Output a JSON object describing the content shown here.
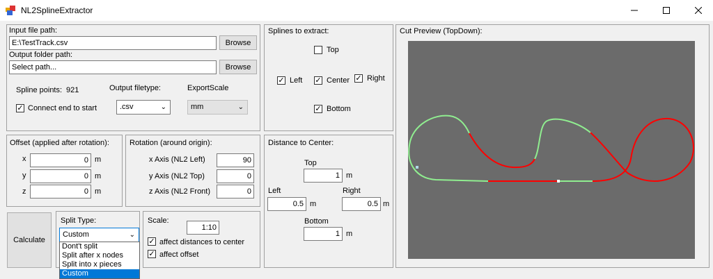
{
  "window": {
    "title": "NL2SplineExtractor",
    "minimize_icon": "minimize-icon",
    "maximize_icon": "maximize-icon",
    "close_icon": "close-icon"
  },
  "io": {
    "input_label": "Input file path:",
    "input_value": "E:\\TestTrack.csv",
    "browse_input": "Browse",
    "output_label": "Output folder path:",
    "output_value": "Select path...",
    "browse_output": "Browse",
    "spline_points_label": "Spline points:",
    "spline_points_value": "921",
    "filetype_label": "Output filetype:",
    "filetype_value": ".csv",
    "exportscale_label": "ExportScale",
    "exportscale_value": "mm",
    "connect_label": "Connect end to start",
    "connect_checked": true
  },
  "offset": {
    "title": "Offset (applied after rotation):",
    "rows": [
      {
        "axis": "x",
        "value": "0",
        "unit": "m"
      },
      {
        "axis": "y",
        "value": "0",
        "unit": "m"
      },
      {
        "axis": "z",
        "value": "0",
        "unit": "m"
      }
    ]
  },
  "rotation": {
    "title": "Rotation (around origin):",
    "rows": [
      {
        "label": "x Axis (NL2 Left)",
        "value": "90"
      },
      {
        "label": "y Axis (NL2 Top)",
        "value": "0"
      },
      {
        "label": "z Axis (NL2 Front)",
        "value": "0"
      }
    ]
  },
  "calculate": {
    "label": "Calculate"
  },
  "split": {
    "label": "Split Type:",
    "value": "Custom",
    "options": [
      "Dont't split",
      "Split after x nodes",
      "Split into x pieces",
      "Custom"
    ],
    "selected_index": 3
  },
  "scale": {
    "label": "Scale:",
    "value": "1:10",
    "affect_distances_label": "affect distances to center",
    "affect_distances_checked": true,
    "affect_offset_label": "affect offset",
    "affect_offset_checked": true
  },
  "splines": {
    "title": "Splines to extract:",
    "top": {
      "label": "Top",
      "checked": false
    },
    "left": {
      "label": "Left",
      "checked": true
    },
    "center": {
      "label": "Center",
      "checked": true
    },
    "right": {
      "label": "Right",
      "checked": true
    },
    "bottom": {
      "label": "Bottom",
      "checked": true
    }
  },
  "distance": {
    "title": "Distance to Center:",
    "top_label": "Top",
    "top_value": "1",
    "top_unit": "m",
    "left_label": "Left",
    "left_value": "0.5",
    "left_unit": "m",
    "right_label": "Right",
    "right_value": "0.5",
    "right_unit": "m",
    "bottom_label": "Bottom",
    "bottom_value": "1",
    "bottom_unit": "m"
  },
  "preview": {
    "title": "Cut Preview (TopDown):",
    "background": "#6b6b6b",
    "segment_colors": {
      "a": "#90ee90",
      "b": "#ff0000"
    },
    "check_mark": "✓"
  }
}
